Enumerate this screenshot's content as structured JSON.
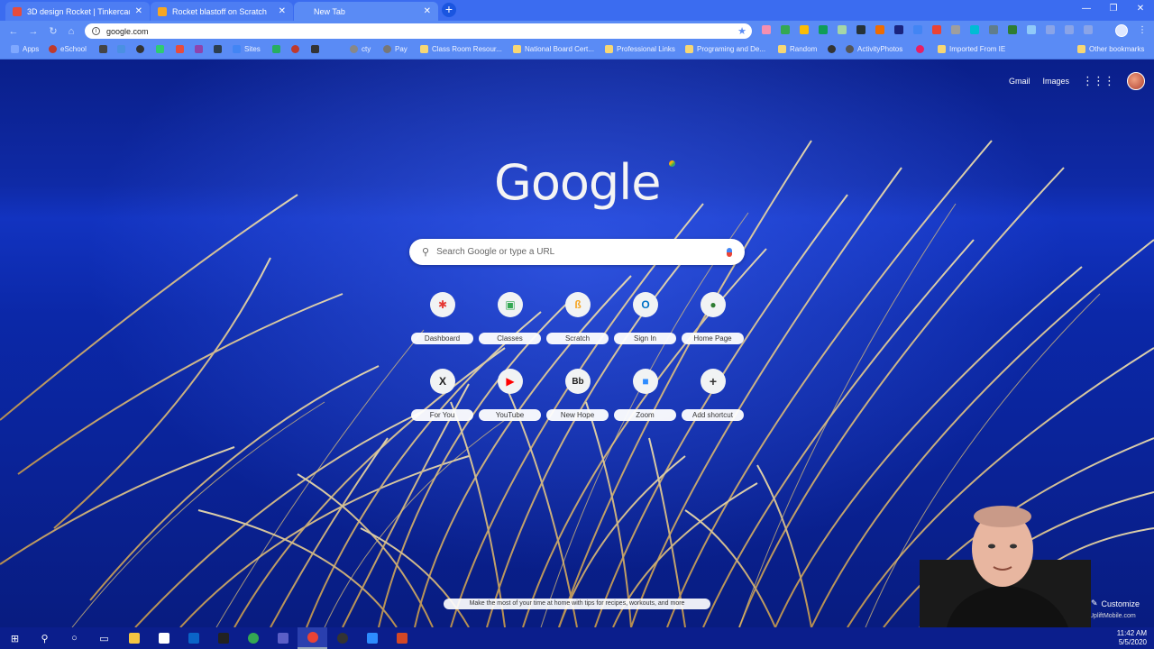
{
  "tabs": [
    {
      "label": "3D design Rocket | Tinkercad",
      "favicon_color": "#e74c3c"
    },
    {
      "label": "Rocket blastoff on Scratch",
      "favicon_color": "#f5a623"
    },
    {
      "label": "New Tab",
      "favicon_color": "#5a8bf5"
    }
  ],
  "toolbar": {
    "url": "google.com"
  },
  "bookmarks": [
    {
      "label": "Apps",
      "color": "#7fa8ff"
    },
    {
      "label": "eSchool",
      "color": "#c0392b"
    },
    {
      "label": "",
      "color": "#444"
    },
    {
      "label": "",
      "color": "#4a90e2"
    },
    {
      "label": "",
      "color": "#333"
    },
    {
      "label": "",
      "color": "#2ecc71"
    },
    {
      "label": "",
      "color": "#e74c3c"
    },
    {
      "label": "",
      "color": "#8e44ad"
    },
    {
      "label": "",
      "color": "#2c3e50"
    },
    {
      "label": "Sites",
      "color": "#4285f4"
    },
    {
      "label": "",
      "color": "#27ae60"
    },
    {
      "label": "",
      "color": "#c0392b"
    },
    {
      "label": "",
      "color": "#333"
    },
    {
      "label": "cty",
      "color": "#888"
    },
    {
      "label": "Pay",
      "color": "#777"
    },
    {
      "label": "Class Room Resour...",
      "color": "#f7d774",
      "folder": true
    },
    {
      "label": "National Board Cert...",
      "color": "#f7d774",
      "folder": true
    },
    {
      "label": "Professional Links",
      "color": "#f7d774",
      "folder": true
    },
    {
      "label": "Programing and De...",
      "color": "#f7d774",
      "folder": true
    },
    {
      "label": "Random",
      "color": "#f7d774",
      "folder": true
    },
    {
      "label": "",
      "color": "#333"
    },
    {
      "label": "ActivityPhotos",
      "color": "#555"
    },
    {
      "label": "",
      "color": "#e91e63"
    },
    {
      "label": "Imported From IE",
      "color": "#f7d774",
      "folder": true
    },
    {
      "label": "Other bookmarks",
      "color": "#f7d774",
      "folder": true
    }
  ],
  "header": {
    "gmail": "Gmail",
    "images": "Images"
  },
  "logo": "Google",
  "search": {
    "placeholder": "Search Google or type a URL"
  },
  "shortcuts": [
    {
      "label": "Dashboard",
      "glyph": "✱",
      "color": "#e53935"
    },
    {
      "label": "Classes",
      "glyph": "▣",
      "color": "#34a853"
    },
    {
      "label": "Scratch",
      "glyph": "ß",
      "color": "#f5a623"
    },
    {
      "label": "Sign In",
      "glyph": "O",
      "color": "#0072c6"
    },
    {
      "label": "Home Page",
      "glyph": "●",
      "color": "#2e7d32"
    },
    {
      "label": "For You",
      "glyph": "X",
      "color": "#222"
    },
    {
      "label": "YouTube",
      "glyph": "▶",
      "color": "#ff0000"
    },
    {
      "label": "New Hope",
      "glyph": "Bb",
      "color": "#222"
    },
    {
      "label": "Zoom",
      "glyph": "■",
      "color": "#2d8cff"
    },
    {
      "label": "Add shortcut",
      "glyph": "+",
      "color": "#333"
    }
  ],
  "footer": {
    "tip": "Make the most of your time at home with tips for recipes, workouts, and more",
    "customize": "Customize",
    "watermark": "UpliftMobile.com"
  },
  "taskbar": {
    "time": "11:42 AM",
    "date": "5/5/2020"
  }
}
